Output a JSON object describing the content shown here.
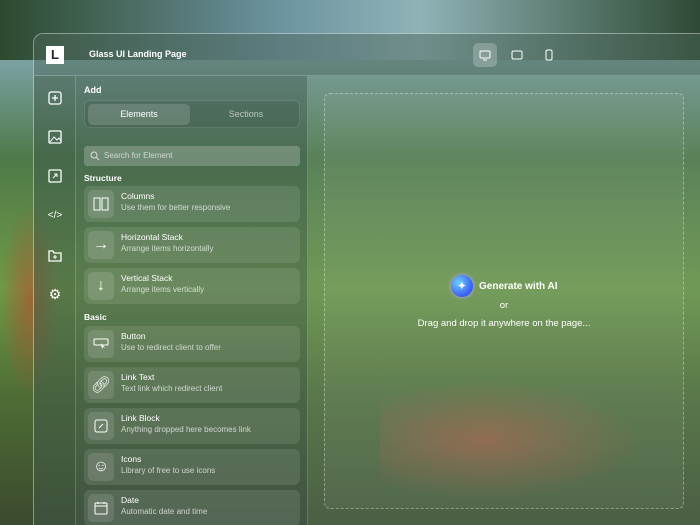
{
  "header": {
    "title": "Glass UI Landing Page",
    "logo": "L",
    "devices": [
      {
        "icon": "desktop-icon",
        "active": true
      },
      {
        "icon": "tablet-icon"
      },
      {
        "icon": "mobile-icon"
      }
    ]
  },
  "rail": [
    "add-icon",
    "image-icon",
    "export-icon",
    "code-icon",
    "folder-add-icon",
    "settings-icon"
  ],
  "panel": {
    "heading": "Add",
    "tabs": [
      "Elements",
      "Sections"
    ],
    "search_placeholder": "Search for Element",
    "structure_label": "Structure",
    "basic_label": "Basic",
    "structure": [
      {
        "name": "Columns",
        "desc": "Use them for better responsive"
      },
      {
        "name": "Horizontal Stack",
        "desc": "Arrange items horizontally"
      },
      {
        "name": "Vertical Stack",
        "desc": "Arrange items vertically"
      }
    ],
    "basic": [
      {
        "name": "Button",
        "desc": "Use to redirect client to offer"
      },
      {
        "name": "Link Text",
        "desc": "Text link which redirect client"
      },
      {
        "name": "Link Block",
        "desc": "Anything dropped here becomes link"
      },
      {
        "name": "Icons",
        "desc": "Library of free to use icons"
      },
      {
        "name": "Date",
        "desc": "Automatic date and time"
      }
    ]
  },
  "canvas": {
    "generate": "Generate with AI",
    "or": "or",
    "drag": "Drag and drop it anywhere on the page..."
  }
}
